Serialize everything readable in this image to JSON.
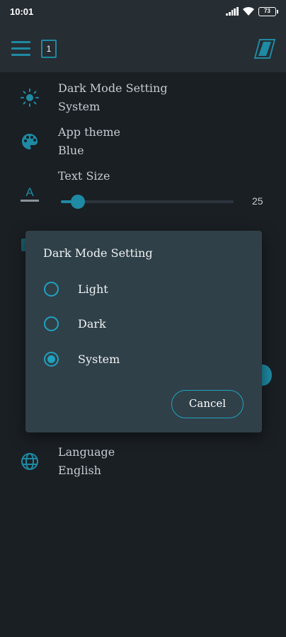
{
  "status_bar": {
    "time": "10:01",
    "battery": "73"
  },
  "app_bar": {
    "tab_count": "1"
  },
  "settings": {
    "dark_mode": {
      "title": "Dark Mode Setting",
      "value": "System"
    },
    "app_theme": {
      "title": "App theme",
      "value": "Blue"
    },
    "text_size": {
      "title": "Text Size",
      "value": "25",
      "level": 0.1
    },
    "language": {
      "title": "Language",
      "value": "English"
    }
  },
  "dialog": {
    "title": "Dark Mode Setting",
    "options": [
      {
        "label": "Light",
        "checked": false
      },
      {
        "label": "Dark",
        "checked": false
      },
      {
        "label": "System",
        "checked": true
      }
    ],
    "cancel_label": "Cancel"
  },
  "colors": {
    "accent": "#1e8aa3",
    "background": "#1a1f24",
    "dialog": "#304048"
  }
}
